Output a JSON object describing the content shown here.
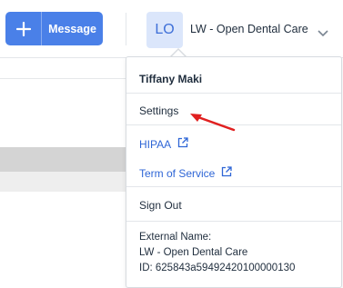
{
  "header": {
    "message_button_label": "Message",
    "avatar_initials": "LO",
    "account_name": "LW - Open Dental Care"
  },
  "dropdown": {
    "user_name": "Tiffany Maki",
    "settings_label": "Settings",
    "links": [
      {
        "label": "HIPAA",
        "icon": "external-link-icon"
      },
      {
        "label": "Term of Service",
        "icon": "external-link-icon"
      }
    ],
    "signout_label": "Sign Out",
    "external_name_label": "External Name:",
    "external_name_value": "LW - Open Dental Care",
    "external_id_text": "ID: 625843a59492420100000130"
  },
  "colors": {
    "accent": "#4a80e8",
    "link": "#2f66d6",
    "annotation_arrow": "#e02020"
  }
}
